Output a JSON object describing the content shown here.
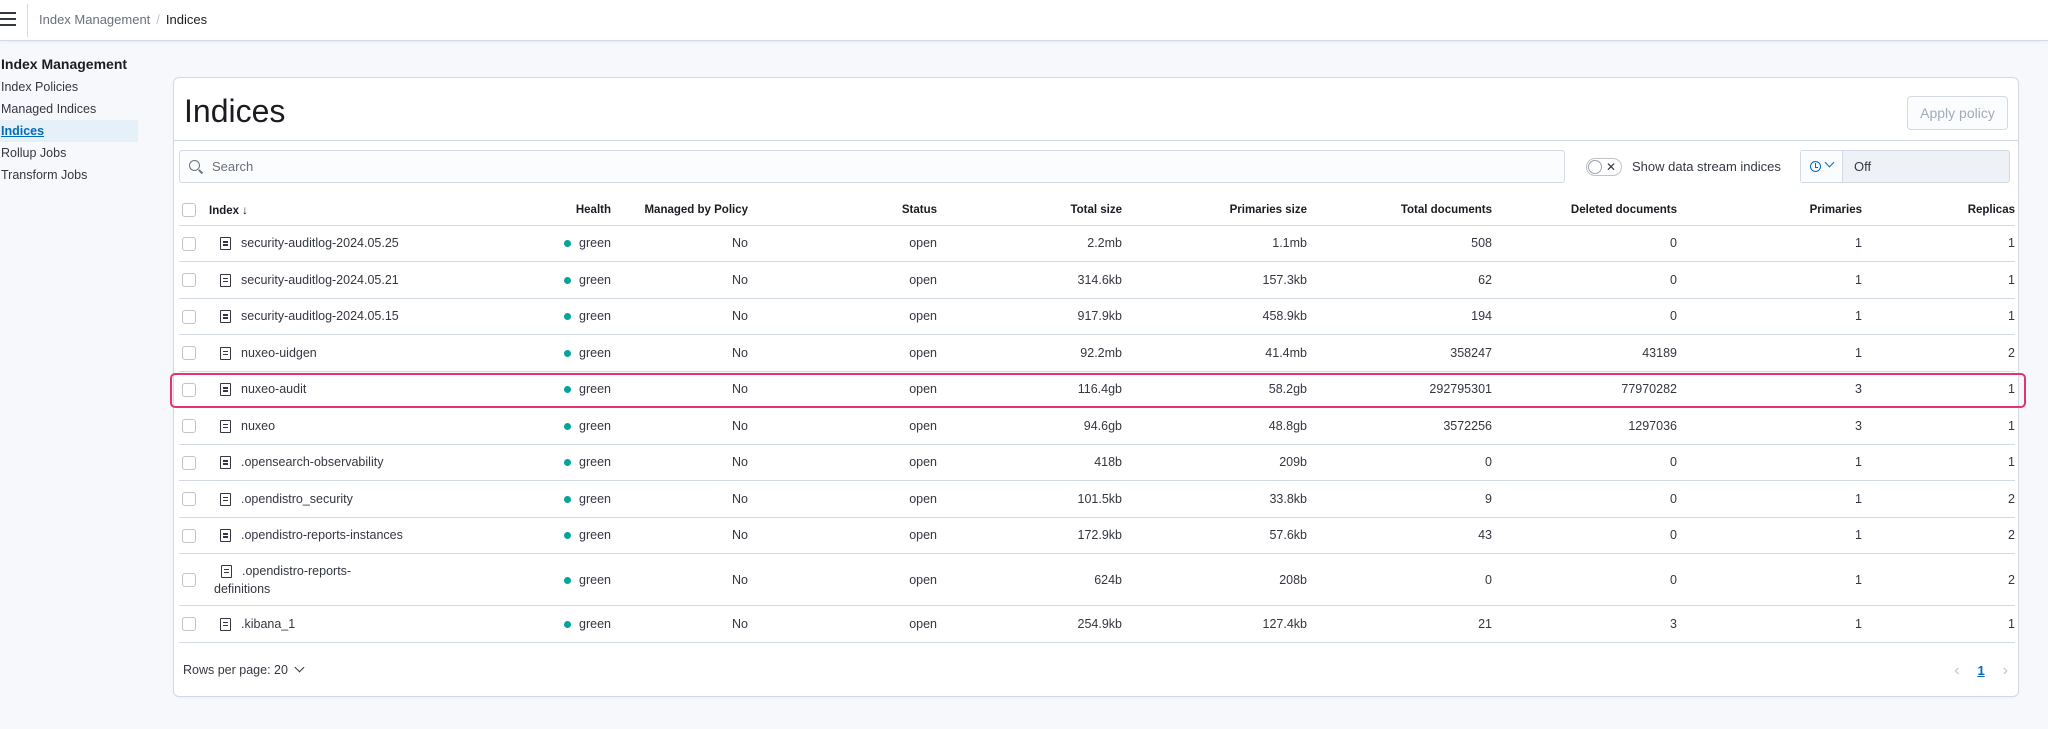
{
  "breadcrumb": {
    "items": [
      "Index Management",
      "Indices"
    ],
    "separator": "/"
  },
  "sidebar": {
    "title": "Index Management",
    "items": [
      {
        "label": "Index Policies",
        "active": false
      },
      {
        "label": "Managed Indices",
        "active": false
      },
      {
        "label": "Indices",
        "active": true
      },
      {
        "label": "Rollup Jobs",
        "active": false
      },
      {
        "label": "Transform Jobs",
        "active": false
      }
    ]
  },
  "main": {
    "title": "Indices",
    "apply_policy_label": "Apply policy",
    "search_placeholder": "Search",
    "toggle_label": "Show data stream indices",
    "toggle_icon": "cross-icon",
    "refresh_value": "Off",
    "columns": {
      "index": "Index",
      "health": "Health",
      "managed": "Managed by Policy",
      "status": "Status",
      "total_size": "Total size",
      "primaries_size": "Primaries size",
      "total_documents": "Total documents",
      "deleted_documents": "Deleted documents",
      "primaries": "Primaries",
      "replicas": "Replicas"
    },
    "rows": [
      {
        "name": "security-auditlog-2024.05.25",
        "health": "green",
        "managed": "No",
        "status": "open",
        "total_size": "2.2mb",
        "primaries_size": "1.1mb",
        "total_documents": "508",
        "deleted_documents": "0",
        "primaries": "1",
        "replicas": "1"
      },
      {
        "name": "security-auditlog-2024.05.21",
        "health": "green",
        "managed": "No",
        "status": "open",
        "total_size": "314.6kb",
        "primaries_size": "157.3kb",
        "total_documents": "62",
        "deleted_documents": "0",
        "primaries": "1",
        "replicas": "1"
      },
      {
        "name": "security-auditlog-2024.05.15",
        "health": "green",
        "managed": "No",
        "status": "open",
        "total_size": "917.9kb",
        "primaries_size": "458.9kb",
        "total_documents": "194",
        "deleted_documents": "0",
        "primaries": "1",
        "replicas": "1"
      },
      {
        "name": "nuxeo-uidgen",
        "health": "green",
        "managed": "No",
        "status": "open",
        "total_size": "92.2mb",
        "primaries_size": "41.4mb",
        "total_documents": "358247",
        "deleted_documents": "43189",
        "primaries": "1",
        "replicas": "2"
      },
      {
        "name": "nuxeo-audit",
        "health": "green",
        "managed": "No",
        "status": "open",
        "total_size": "116.4gb",
        "primaries_size": "58.2gb",
        "total_documents": "292795301",
        "deleted_documents": "77970282",
        "primaries": "3",
        "replicas": "1"
      },
      {
        "name": "nuxeo",
        "health": "green",
        "managed": "No",
        "status": "open",
        "total_size": "94.6gb",
        "primaries_size": "48.8gb",
        "total_documents": "3572256",
        "deleted_documents": "1297036",
        "primaries": "3",
        "replicas": "1"
      },
      {
        "name": ".opensearch-observability",
        "health": "green",
        "managed": "No",
        "status": "open",
        "total_size": "418b",
        "primaries_size": "209b",
        "total_documents": "0",
        "deleted_documents": "0",
        "primaries": "1",
        "replicas": "1"
      },
      {
        "name": ".opendistro_security",
        "health": "green",
        "managed": "No",
        "status": "open",
        "total_size": "101.5kb",
        "primaries_size": "33.8kb",
        "total_documents": "9",
        "deleted_documents": "0",
        "primaries": "1",
        "replicas": "2"
      },
      {
        "name": ".opendistro-reports-instances",
        "health": "green",
        "managed": "No",
        "status": "open",
        "total_size": "172.9kb",
        "primaries_size": "57.6kb",
        "total_documents": "43",
        "deleted_documents": "0",
        "primaries": "1",
        "replicas": "2"
      },
      {
        "name_line1": ".opendistro-reports-",
        "name_line2": "definitions",
        "health": "green",
        "managed": "No",
        "status": "open",
        "total_size": "624b",
        "primaries_size": "208b",
        "total_documents": "0",
        "deleted_documents": "0",
        "primaries": "1",
        "replicas": "2"
      },
      {
        "name": ".kibana_1",
        "health": "green",
        "managed": "No",
        "status": "open",
        "total_size": "254.9kb",
        "primaries_size": "127.4kb",
        "total_documents": "21",
        "deleted_documents": "3",
        "primaries": "1",
        "replicas": "1"
      }
    ],
    "highlighted_row": "nuxeo-audit",
    "rows_per_page_label": "Rows per page: 20",
    "current_page": "1"
  },
  "colors": {
    "accent": "#006bb8",
    "health_green": "#00a69b",
    "highlight_border": "#e8326c"
  }
}
